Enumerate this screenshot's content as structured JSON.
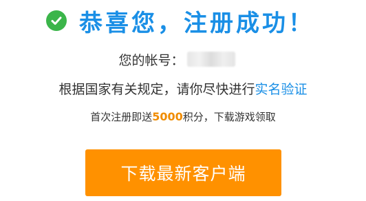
{
  "header": {
    "title": "恭喜您，注册成功！",
    "icon": "check-circle-icon",
    "icon_color": "#3bb54a",
    "title_color": "#1a8fe6"
  },
  "account": {
    "label": "您的帐号："
  },
  "notice": {
    "text": "根据国家有关规定，请你尽快进行",
    "link_label": "实名验证",
    "link_color": "#1a8fe6"
  },
  "bonus": {
    "prefix": "首次注册即送",
    "points": "5000",
    "suffix": "积分，下载游戏领取",
    "points_color": "#f08c00"
  },
  "download": {
    "label": "下载最新客户端",
    "button_color": "#ff9100"
  }
}
